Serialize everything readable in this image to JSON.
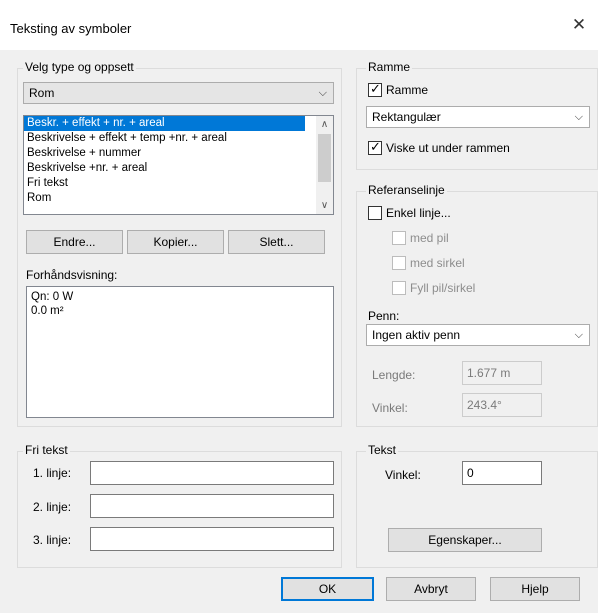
{
  "window": {
    "title": "Teksting av symboler",
    "close_glyph": "✕"
  },
  "type_group": {
    "label": "Velg type og oppsett",
    "combo_value": "Rom",
    "list_items": [
      "Beskr. + effekt + nr. + areal",
      "Beskrivelse + effekt + temp +nr. + areal",
      "Beskrivelse + nummer",
      "Beskrivelse +nr. + areal",
      "Fri tekst",
      "Rom"
    ],
    "selected_index": 0,
    "buttons": {
      "edit": "Endre...",
      "copy": "Kopier...",
      "delete": "Slett..."
    },
    "preview_label": "Forhåndsvisning:",
    "preview_lines": [
      "Qn: 0 W",
      "0.0 m²"
    ]
  },
  "frame_group": {
    "label": "Ramme",
    "frame_checkbox": "Ramme",
    "frame_checked": true,
    "shape_value": "Rektangulær",
    "erase_checkbox": "Viske ut under rammen",
    "erase_checked": true
  },
  "ref_group": {
    "label": "Referanselinje",
    "simple_line": "Enkel linje...",
    "simple_line_checked": false,
    "with_arrow": "med pil",
    "with_circle": "med sirkel",
    "fill_arrow": "Fyll pil/sirkel",
    "pen_label": "Penn:",
    "pen_value": "Ingen aktiv penn",
    "length_label": "Lengde:",
    "length_value": "1.677 m",
    "angle_label": "Vinkel:",
    "angle_value": "243.4°"
  },
  "free_text_group": {
    "label": "Fri tekst",
    "line1": "1. linje:",
    "line2": "2. linje:",
    "line3": "3. linje:",
    "line1_value": "",
    "line2_value": "",
    "line3_value": ""
  },
  "text_group": {
    "label": "Tekst",
    "angle_label": "Vinkel:",
    "angle_value": "0",
    "properties_button": "Egenskaper..."
  },
  "footer": {
    "ok": "OK",
    "cancel": "Avbryt",
    "help": "Hjelp"
  },
  "icons": {
    "combo_arrow": "⌵",
    "scroll_up": "∧",
    "scroll_down": "∨"
  }
}
